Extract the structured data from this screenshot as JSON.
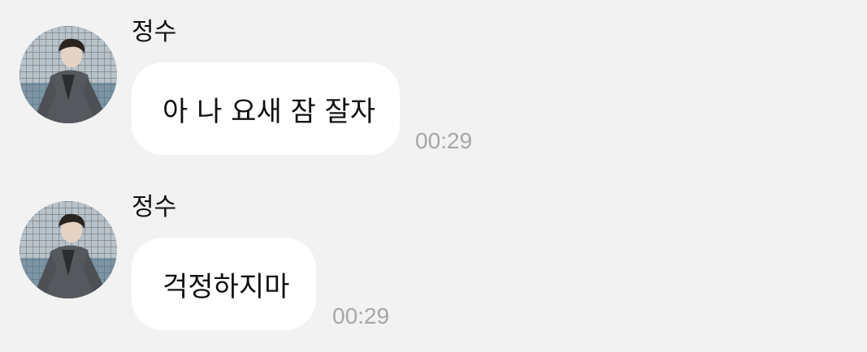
{
  "messages": [
    {
      "sender": "정수",
      "text": "아 나 요새 잠 잘자",
      "time": "00:29"
    },
    {
      "sender": "정수",
      "text": "걱정하지마",
      "time": "00:29"
    }
  ],
  "colors": {
    "background": "#f2f2f2",
    "bubble": "#ffffff",
    "time_text": "#a7a7a7"
  }
}
